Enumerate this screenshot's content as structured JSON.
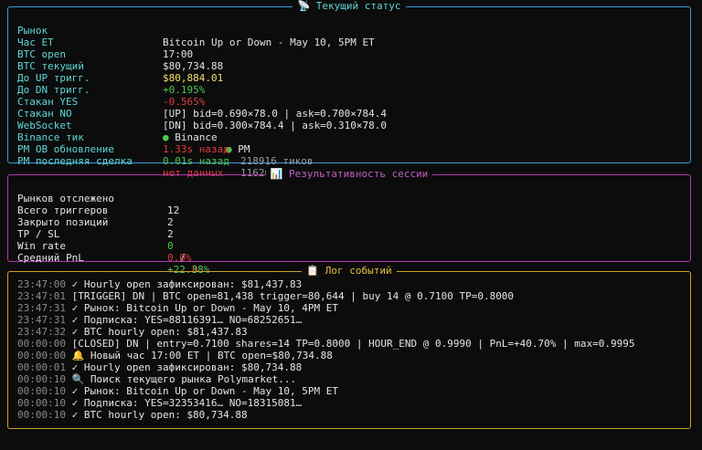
{
  "status_panel": {
    "title": "📡 Текущий статус",
    "border_color": "#3a9ad9",
    "rows": [
      {
        "label": "Рынок",
        "value": "Bitcoin Up or Down - May 10, 5PM ET"
      },
      {
        "label": "Час ET",
        "value": "17:00"
      },
      {
        "label": "BTC open",
        "value": "$80,734.88"
      },
      {
        "label": "BTC текущий",
        "value": "$80,884.01"
      },
      {
        "label": "До UP тригг.",
        "value": "+0.195%"
      },
      {
        "label": "До DN тригг.",
        "value": "-0.565%"
      },
      {
        "label": "Стакан YES",
        "value": "[UP] bid=0.690×78.0 | ask=0.700×784.4"
      },
      {
        "label": "Стакан NO",
        "value": "[DN] bid=0.300×784.4 | ask=0.310×78.0"
      },
      {
        "label": "WebSocket",
        "value_a": "● Binance",
        "value_b": "● PM"
      },
      {
        "label": "Binance тик",
        "value_a": "1.33s назад",
        "value_b": "218916 тиков"
      },
      {
        "label": "PM OB обновление",
        "value_a": "0.01s назад",
        "value_b": "1162079 апд."
      },
      {
        "label": "PM последняя сделка",
        "value": "нет данных"
      }
    ]
  },
  "session_panel": {
    "title": "📊 Результативность сессии",
    "border_color": "#b23ab2",
    "rows": [
      {
        "label": "Рынков отслежено",
        "value": "12"
      },
      {
        "label": "Всего триггеров",
        "value": "2"
      },
      {
        "label": "Закрыто позиций",
        "value": "2"
      },
      {
        "label": "TP / SL",
        "value_a": "0",
        "sep": " / ",
        "value_b": "0"
      },
      {
        "label": "Win rate",
        "value": "0.0%"
      },
      {
        "label": "Средний PnL",
        "value": "+22.38%"
      }
    ]
  },
  "log_panel": {
    "title": "📋 Лог событий",
    "border_color": "#c9a227",
    "entries": [
      {
        "ts": "23:47:00",
        "msg": "✓ Hourly open зафиксирован: $81,437.83"
      },
      {
        "ts": "23:47:01",
        "msg": "[TRIGGER] DN | BTC open=81,438 trigger=80,644 | buy 14 @ 0.7100 TP=0.8000"
      },
      {
        "ts": "23:47:31",
        "msg": "✓ Рынок: Bitcoin Up or Down - May 10, 4PM ET"
      },
      {
        "ts": "23:47:31",
        "msg": "✓ Подписка: YES=88116391… NO=68252651…"
      },
      {
        "ts": "23:47:32",
        "msg": "✓ BTC hourly open: $81,437.83"
      },
      {
        "ts": "00:00:00",
        "msg": "[CLOSED] DN | entry=0.7100 shares=14 TP=0.8000 | HOUR_END @ 0.9990 | PnL=+40.70% | max=0.9995"
      },
      {
        "ts": "00:00:00",
        "msg": "🔔 Новый час 17:00 ET | BTC open=$80,734.88"
      },
      {
        "ts": "00:00:01",
        "msg": "✓ Hourly open зафиксирован: $80,734.88"
      },
      {
        "ts": "00:00:10",
        "msg": "🔍 Поиск текущего рынка Polymarket..."
      },
      {
        "ts": "00:00:10",
        "msg": "✓ Рынок: Bitcoin Up or Down - May 10, 5PM ET"
      },
      {
        "ts": "00:00:10",
        "msg": "✓ Подписка: YES=32353416… NO=18315081…"
      },
      {
        "ts": "00:00:10",
        "msg": "✓ BTC hourly open: $80,734.88"
      }
    ]
  }
}
